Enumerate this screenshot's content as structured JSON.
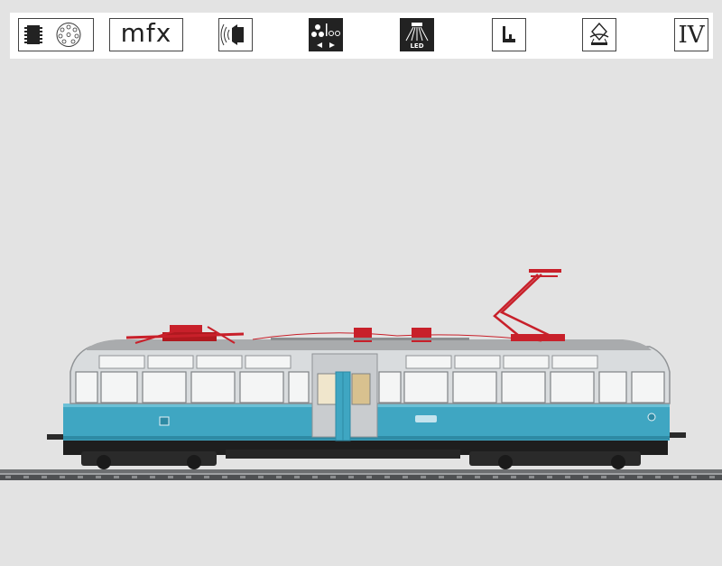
{
  "icon_bar": {
    "icons": [
      {
        "name": "digital-decoder-icon"
      },
      {
        "name": "mfx-icon",
        "text": "mfx"
      },
      {
        "name": "sound-icon"
      },
      {
        "name": "sound-functions-icon"
      },
      {
        "name": "led-lighting-icon",
        "text": "LED"
      },
      {
        "name": "interior-seat-icon"
      },
      {
        "name": "interior-lighting-icon"
      },
      {
        "name": "era-icon",
        "text": "IV"
      }
    ]
  },
  "colors": {
    "background": "#e3e3e3",
    "body_turquoise": "#3fa6c2",
    "roof_grey": "#a9abad",
    "pantograph_red": "#c8202a",
    "undercarriage": "#1e1e1e"
  }
}
